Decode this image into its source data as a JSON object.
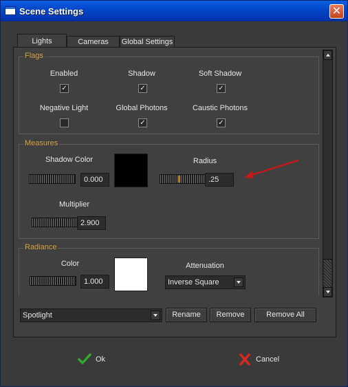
{
  "window": {
    "title": "Scene Settings",
    "close_label": "✕"
  },
  "tabs": [
    {
      "label": "Lights"
    },
    {
      "label": "Cameras"
    },
    {
      "label": "Global Settings"
    }
  ],
  "flags": {
    "title": "Flags",
    "items": [
      {
        "label": "Enabled",
        "checked": true,
        "mark": "✓"
      },
      {
        "label": "Shadow",
        "checked": true,
        "mark": "✓"
      },
      {
        "label": "Soft Shadow",
        "checked": true,
        "mark": "✓"
      },
      {
        "label": "Negative Light",
        "checked": false,
        "mark": ""
      },
      {
        "label": "Global Photons",
        "checked": true,
        "mark": "✓"
      },
      {
        "label": "Caustic Photons",
        "checked": true,
        "mark": "✓"
      }
    ]
  },
  "measures": {
    "title": "Measures",
    "shadow_color": {
      "label": "Shadow Color",
      "value": "0.000",
      "swatch": "#000000"
    },
    "radius": {
      "label": "Radius",
      "value": ".25"
    },
    "multiplier": {
      "label": "Multiplier",
      "value": "2.900"
    }
  },
  "radiance": {
    "title": "Radiance",
    "color": {
      "label": "Color",
      "value": "1.000",
      "swatch": "#ffffff"
    },
    "attenuation": {
      "label": "Attenuation",
      "value": "Inverse Square"
    }
  },
  "light_select": {
    "value": "Spotlight"
  },
  "buttons": {
    "rename": "Rename",
    "remove": "Remove",
    "remove_all": "Remove All"
  },
  "footer": {
    "ok": "Ok",
    "cancel": "Cancel"
  },
  "colors": {
    "accent_group_title": "#d6a040",
    "annotation_arrow": "#c21a1a"
  }
}
